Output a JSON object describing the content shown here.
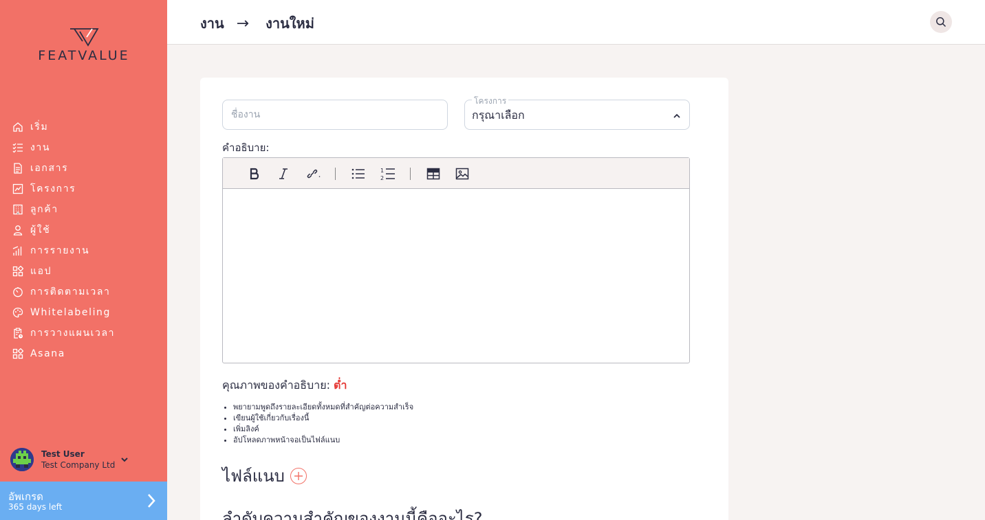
{
  "app": {
    "logo_text": "FEATVALUE"
  },
  "sidebar": {
    "items": [
      {
        "label": "เริ่ม",
        "icon": "home-icon"
      },
      {
        "label": "งาน",
        "icon": "tasks-icon"
      },
      {
        "label": "เอกสาร",
        "icon": "document-icon"
      },
      {
        "label": "โครงการ",
        "icon": "chart-icon"
      },
      {
        "label": "ลูกค้า",
        "icon": "building-icon"
      },
      {
        "label": "ผู้ใช้",
        "icon": "user-icon"
      },
      {
        "label": "การรายงาน",
        "icon": "bar-chart-icon"
      },
      {
        "label": "แอป",
        "icon": "apps-icon"
      },
      {
        "label": "การติดตามเวลา",
        "icon": "timer-icon"
      },
      {
        "label": "Whitelabeling",
        "icon": "palette-icon"
      },
      {
        "label": "การวางแผนเวลา",
        "icon": "clipboard-clock-icon"
      },
      {
        "label": "Asana",
        "icon": "apps-icon"
      }
    ],
    "user": {
      "name": "Test User",
      "company": "Test Company Ltd"
    },
    "upgrade": {
      "title": "อัพเกรด",
      "subtitle": "365 days left"
    }
  },
  "header": {
    "crumb_parent": "งาน",
    "crumb_arrow": "→",
    "crumb_current": "งานใหม่"
  },
  "form": {
    "name_placeholder": "ชื่องาน",
    "project_label": "โครงการ",
    "project_value": "กรุณาเลือก",
    "description_label": "คำอธิบาย:",
    "quality_label": "คุณภาพของคำอธิบาย:",
    "quality_value": "ต่ำ",
    "tips": [
      "พยายามพูดถึงรายละเอียดทั้งหมดที่สำคัญต่อความสำเร็จ",
      "เขียนผู้ใช้เกี่ยวกับเรื่องนี้",
      "เพิ่มลิงค์",
      "อัปโหลดภาพหน้าจอเป็นไฟล์แนบ"
    ],
    "attachments_label": "ไฟล์แนบ",
    "priority_question": "ลำดับความสำคัญของงานนี้คืออะไร?"
  },
  "colors": {
    "sidebar": "#f27167",
    "upgrade": "#6aaef2",
    "accent_low": "#e53935"
  }
}
